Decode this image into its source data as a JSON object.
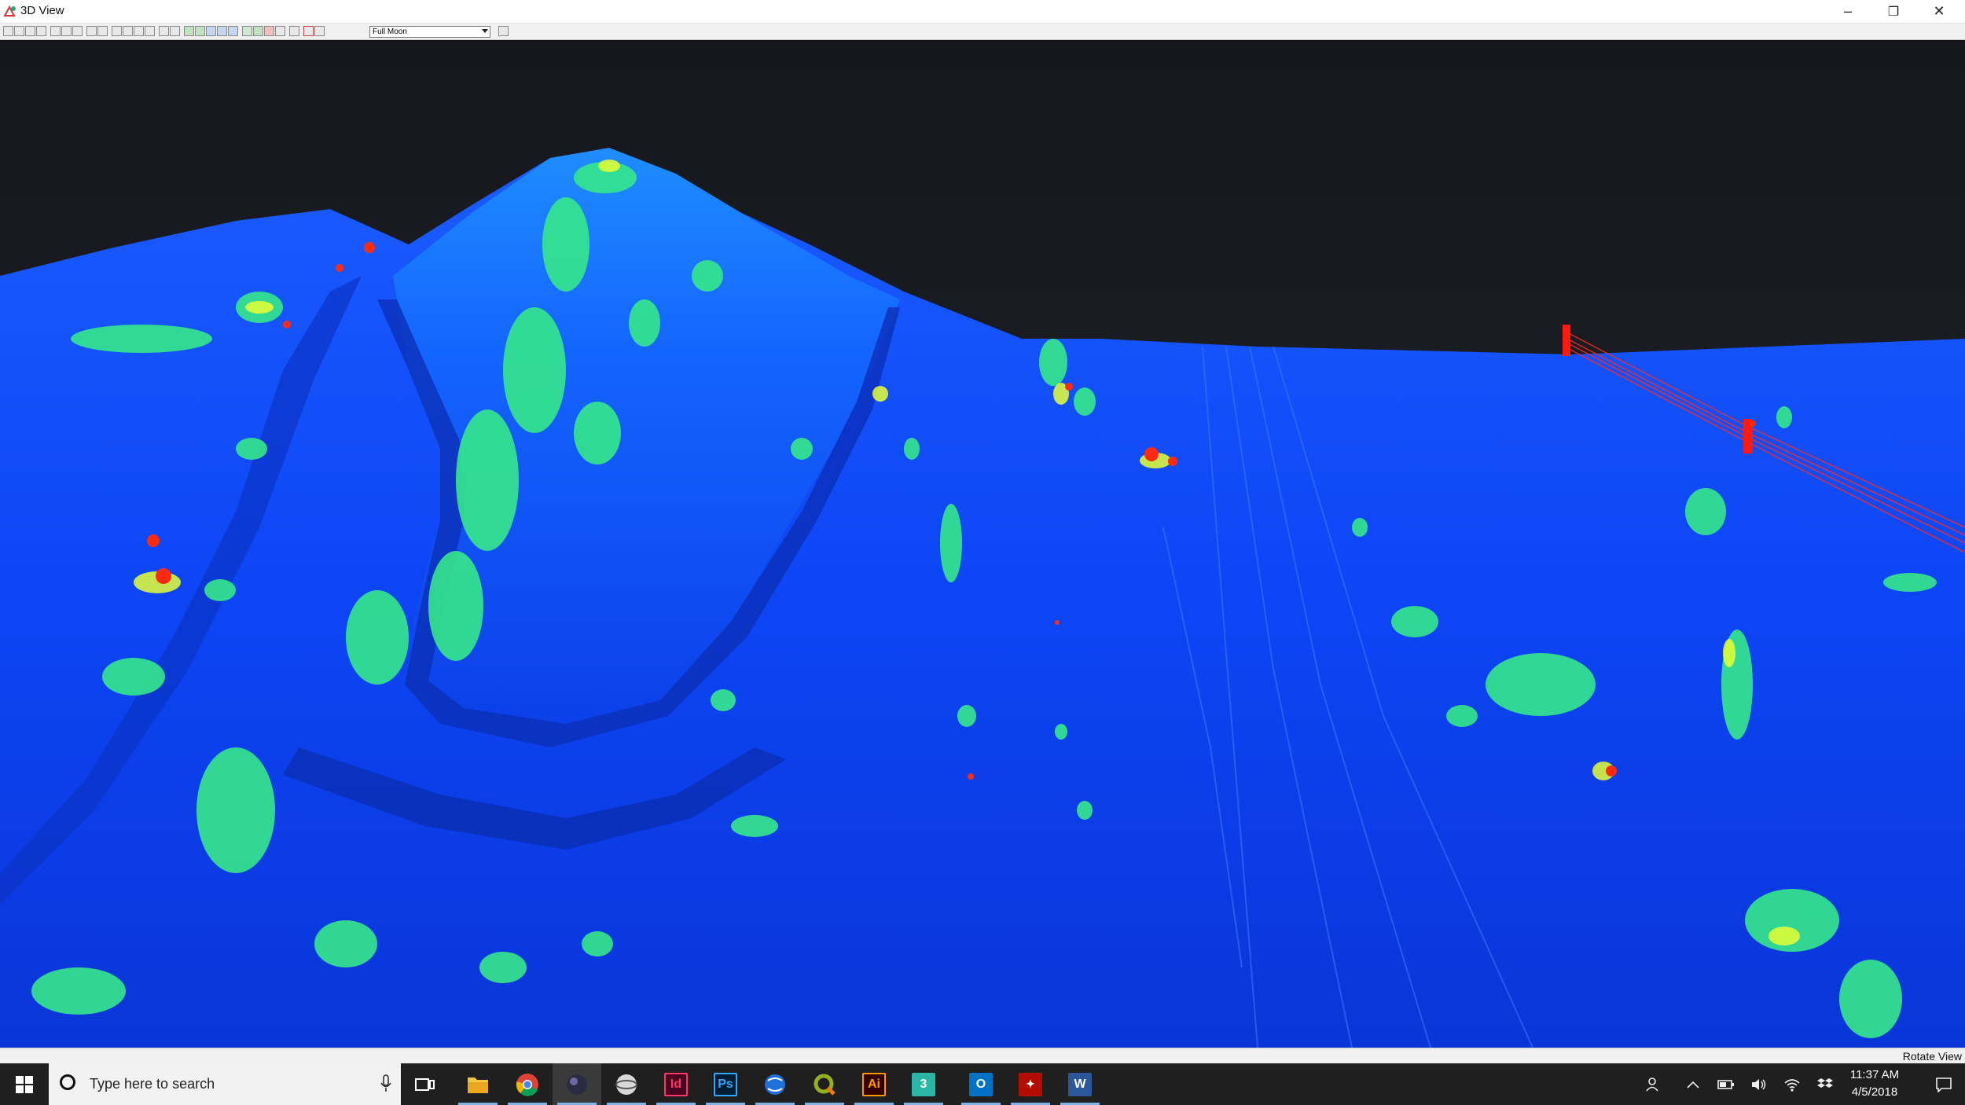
{
  "window": {
    "title": "3D View",
    "controls": {
      "minimize": "–",
      "restore": "❐",
      "close": "✕"
    }
  },
  "toolbar": {
    "view_mode_select": "Full Moon",
    "icons": [
      "select-icon",
      "pan-icon",
      "zoom-box-icon",
      "rotate-icon",
      "measure-icon",
      "fit-icon",
      "clip-icon",
      "layer-icon",
      "render-icon",
      "color-icon",
      "save-icon",
      "settings-icon"
    ]
  },
  "viewport": {
    "description_colors": {
      "sky": "#1c1f26",
      "ground_low": "#0b3df0",
      "ground_mid": "#1a6cff",
      "veg_green": "#3dff7a",
      "veg_yellow": "#f2ff2e",
      "veg_red": "#ff2a10"
    }
  },
  "statusbar": {
    "mode": "Rotate View"
  },
  "taskbar": {
    "search_placeholder": "Type here to search",
    "apps": [
      {
        "name": "task-view",
        "label": ""
      },
      {
        "name": "file-explorer",
        "label": ""
      },
      {
        "name": "chrome",
        "label": ""
      },
      {
        "name": "point-cloud-viewer",
        "label": ""
      },
      {
        "name": "app-globe",
        "label": ""
      },
      {
        "name": "indesign",
        "label": "Id"
      },
      {
        "name": "photoshop",
        "label": "Ps"
      },
      {
        "name": "app-blue-globe",
        "label": ""
      },
      {
        "name": "qgis",
        "label": "Q"
      },
      {
        "name": "illustrator",
        "label": "Ai"
      },
      {
        "name": "app-3",
        "label": "3"
      },
      {
        "name": "outlook",
        "label": "O"
      },
      {
        "name": "acrobat",
        "label": "✦"
      },
      {
        "name": "word",
        "label": "W"
      }
    ],
    "clock": {
      "time": "11:37 AM",
      "date": "4/5/2018"
    }
  }
}
